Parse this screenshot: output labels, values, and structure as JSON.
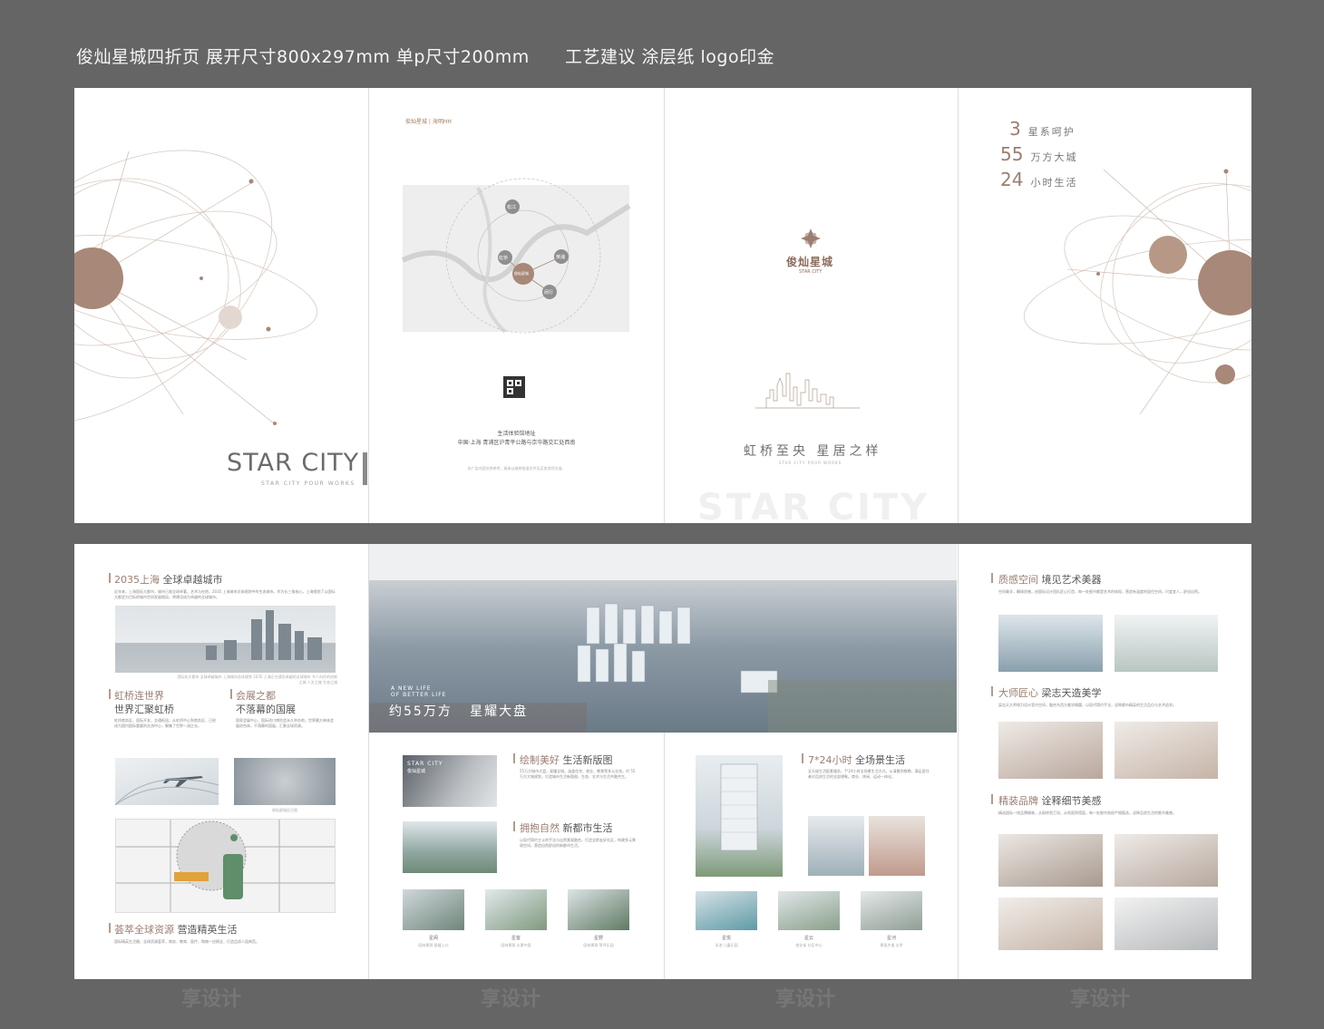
{
  "spec_line": "俊灿星城四折页 展开尺寸800x297mm 单p尺寸200mm      工艺建议 涂层纸 logo印金",
  "outer": {
    "cover": {
      "title": "STAR CITY",
      "subtitle": "STAR CITY POUR WORKS"
    },
    "map_page": {
      "logo": "俊灿星城 | 海明HH",
      "nodes": [
        "虹桥",
        "黄浦",
        "松江",
        "闵行",
        "俊灿星城"
      ],
      "address_title": "生活体验馆地址",
      "address": "中国·上海  青浦区沪青平公路与京华路交汇处西南",
      "fine_print": "本广告内容仅供参考，具体以政府批准文件及买卖合同为准。"
    },
    "brand_page": {
      "logo_cn": "俊灿星城",
      "logo_en": "STAR CITY",
      "slogan": "虹桥至央 星居之样",
      "slogan_en": "STAR CITY POUR WORKS",
      "ghost": "STAR CITY"
    },
    "stats_page": {
      "stats": [
        {
          "num": "3",
          "label": "星系呵护"
        },
        {
          "num": "55",
          "label": "万方大城"
        },
        {
          "num": "24",
          "label": "小时生活"
        }
      ]
    }
  },
  "inner": {
    "p1": {
      "s1_hl": "2035上海",
      "s1_rest": "全球卓越城市",
      "s1_body": "近年来，上海国际大都市，城市已渐全球卓著，艺术与在地，2035 上海城市总体规划中的生态城市。作为长三角核心，上海规划了以国际大都会为目标的城市空间发展格局，将建设成为卓越的全球城市。",
      "s1_cap": "国际化大都市 全球卓越城市 上海城市总体规划 2035 上海正在建设卓越的全球城市 令人向往的创新之城 人文之城 生态之城",
      "s2_hl": "虹桥连世界",
      "s2_rest": "世界汇聚虹桥",
      "s2_body": "虹桥商务区，国际开发，交通枢纽，从虹桥中心到商务区，已经成为国内国际重要的交流中心，聚集了世界一流企业。",
      "s3_hl": "会展之都",
      "s3_rest": "不落幕的国展",
      "s3_body": "国家会展中心，国际进口博览会永久举办地，世界最大单体会展综合体，不落幕的国展，汇聚全球资源。",
      "map_cap": "俊灿星城区位图",
      "s4_hl": "荟萃全球资源",
      "s4_rest": "营造精英生活",
      "s4_body": "国际精英生活圈，全球资源荟萃，商务、教育、医疗、购物一应俱全，打造品质人居典范。"
    },
    "p2": {
      "aerial_en1": "A NEW LIFE",
      "aerial_en2": "OF BETTER LIFE",
      "aerial_title": "约55万方   星耀大盘",
      "card_title": "STAR CITY",
      "card_sub": "俊灿星城",
      "s1_hl": "绘制美好",
      "s1_rest": "生活新版图",
      "s1_body": "55万方城市大盘，星耀全城，涵盖住宅、商业、教育等多元业态，约 55 万方大城规划，打造城市生活新版图，生态、艺术与生活共融共生。",
      "s2_hl": "拥抱自然",
      "s2_rest": "新都市生活",
      "s2_body": "以现代简约主义的手法与自然景观融合，打造全龄友好社区，构建多元景观空间，营造自然舒适的新都市生活。",
      "gallery": [
        {
          "name": "星阁",
          "sub": "园林景观 星耀入口"
        },
        {
          "name": "星客",
          "sub": "园林景观 水景中庭"
        },
        {
          "name": "星野",
          "sub": "园林景观 草坪乐园"
        }
      ]
    },
    "p3": {
      "s1_hl": "7*24小时",
      "s1_rest": "全场景生活",
      "s1_body": "全天候生活配套服务，7*24小时全场景生活方式，从清晨到夜晚，满足居住者对品质生活的全部想象。商业、休闲、运动一体化。",
      "gallery": [
        {
          "name": "星悦",
          "sub": "泳池 儿童乐园"
        },
        {
          "name": "星云",
          "sub": "商业街 社区中心"
        },
        {
          "name": "星河",
          "sub": "景观步道 水岸"
        }
      ]
    },
    "p4": {
      "s1_hl": "质感空间",
      "s1_rest": "境见艺术美器",
      "s1_body": "空间美学，雕琢质感，由国际设计团队匠心打造，每一处细节都是艺术的体现，营造有温度的居住空间，尺度宜人，舒适自然。",
      "s2_hl": "大师匠心",
      "s2_rest": "梁志天造美学",
      "s2_body": "梁志天大师倾力设计室内空间，融合东西方美学精髓，以现代简约手法，诠释都市精英的生活品位与艺术追求。",
      "s3_hl": "精装品牌",
      "s3_rest": "诠释细节美感",
      "s3_body": "精选国际一线品牌精装，从厨房到卫浴，从地面到墙面，每一处细节皆经严格甄选，诠释品质生活的细节美感。"
    }
  },
  "watermark": "享设计",
  "colors": {
    "bg": "#666565",
    "paper": "#ffffff",
    "accent": "#9b7e70",
    "line": "#b49b8c"
  }
}
